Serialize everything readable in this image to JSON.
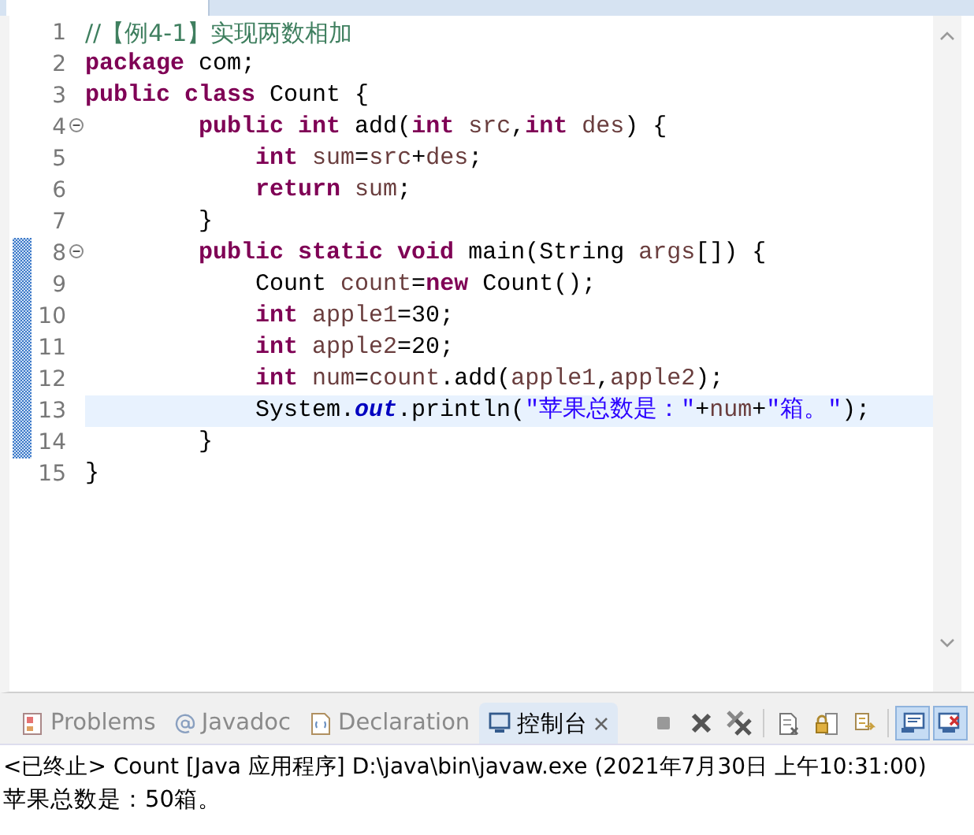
{
  "editor": {
    "lines": [
      {
        "number": "1",
        "fold": false,
        "changed": false,
        "current": false,
        "tokens": [
          {
            "kind": "comment",
            "text": "//【例4-1】实现两数相加"
          }
        ]
      },
      {
        "number": "2",
        "fold": false,
        "changed": false,
        "current": false,
        "tokens": [
          {
            "kind": "keyword",
            "text": "package"
          },
          {
            "kind": "plain",
            "text": " com;"
          }
        ]
      },
      {
        "number": "3",
        "fold": false,
        "changed": false,
        "current": false,
        "tokens": [
          {
            "kind": "keyword",
            "text": "public"
          },
          {
            "kind": "keyword",
            "text": " class"
          },
          {
            "kind": "plain",
            "text": " Count {"
          }
        ]
      },
      {
        "number": "4",
        "fold": true,
        "changed": false,
        "current": false,
        "tokens": [
          {
            "kind": "keyword",
            "text": "        public"
          },
          {
            "kind": "keyword",
            "text": " int"
          },
          {
            "kind": "plain",
            "text": " add("
          },
          {
            "kind": "keyword",
            "text": "int"
          },
          {
            "kind": "variable",
            "text": " src"
          },
          {
            "kind": "plain",
            "text": ","
          },
          {
            "kind": "keyword",
            "text": "int"
          },
          {
            "kind": "variable",
            "text": " des"
          },
          {
            "kind": "plain",
            "text": ") {"
          }
        ]
      },
      {
        "number": "5",
        "fold": false,
        "changed": false,
        "current": false,
        "tokens": [
          {
            "kind": "keyword",
            "text": "            int"
          },
          {
            "kind": "variable",
            "text": " sum"
          },
          {
            "kind": "plain",
            "text": "="
          },
          {
            "kind": "variable",
            "text": "src"
          },
          {
            "kind": "plain",
            "text": "+"
          },
          {
            "kind": "variable",
            "text": "des"
          },
          {
            "kind": "plain",
            "text": ";"
          }
        ]
      },
      {
        "number": "6",
        "fold": false,
        "changed": false,
        "current": false,
        "tokens": [
          {
            "kind": "keyword",
            "text": "            return"
          },
          {
            "kind": "variable",
            "text": " sum"
          },
          {
            "kind": "plain",
            "text": ";"
          }
        ]
      },
      {
        "number": "7",
        "fold": false,
        "changed": false,
        "current": false,
        "tokens": [
          {
            "kind": "plain",
            "text": "        }"
          }
        ]
      },
      {
        "number": "8",
        "fold": true,
        "changed": true,
        "current": false,
        "tokens": [
          {
            "kind": "keyword",
            "text": "        public"
          },
          {
            "kind": "keyword",
            "text": " static"
          },
          {
            "kind": "keyword",
            "text": " void"
          },
          {
            "kind": "plain",
            "text": " main(String"
          },
          {
            "kind": "variable",
            "text": " args"
          },
          {
            "kind": "plain",
            "text": "[]) {"
          }
        ]
      },
      {
        "number": "9",
        "fold": false,
        "changed": true,
        "current": false,
        "tokens": [
          {
            "kind": "plain",
            "text": "            Count"
          },
          {
            "kind": "variable",
            "text": " count"
          },
          {
            "kind": "plain",
            "text": "="
          },
          {
            "kind": "keyword",
            "text": "new"
          },
          {
            "kind": "plain",
            "text": " Count();"
          }
        ]
      },
      {
        "number": "10",
        "fold": false,
        "changed": true,
        "current": false,
        "tokens": [
          {
            "kind": "keyword",
            "text": "            int"
          },
          {
            "kind": "variable",
            "text": " apple1"
          },
          {
            "kind": "plain",
            "text": "=30;"
          }
        ]
      },
      {
        "number": "11",
        "fold": false,
        "changed": true,
        "current": false,
        "tokens": [
          {
            "kind": "keyword",
            "text": "            int"
          },
          {
            "kind": "variable",
            "text": " apple2"
          },
          {
            "kind": "plain",
            "text": "=20;"
          }
        ]
      },
      {
        "number": "12",
        "fold": false,
        "changed": true,
        "current": false,
        "tokens": [
          {
            "kind": "keyword",
            "text": "            int"
          },
          {
            "kind": "variable",
            "text": " num"
          },
          {
            "kind": "plain",
            "text": "="
          },
          {
            "kind": "variable",
            "text": "count"
          },
          {
            "kind": "plain",
            "text": ".add("
          },
          {
            "kind": "variable",
            "text": "apple1"
          },
          {
            "kind": "plain",
            "text": ","
          },
          {
            "kind": "variable",
            "text": "apple2"
          },
          {
            "kind": "plain",
            "text": ");"
          }
        ]
      },
      {
        "number": "13",
        "fold": false,
        "changed": true,
        "current": true,
        "tokens": [
          {
            "kind": "plain",
            "text": "            System."
          },
          {
            "kind": "field",
            "text": "out"
          },
          {
            "kind": "plain",
            "text": ".println("
          },
          {
            "kind": "string",
            "text": "\"苹果总数是：\""
          },
          {
            "kind": "plain",
            "text": "+"
          },
          {
            "kind": "variable",
            "text": "num"
          },
          {
            "kind": "plain",
            "text": "+"
          },
          {
            "kind": "string",
            "text": "\"箱。\""
          },
          {
            "kind": "plain",
            "text": ");"
          }
        ]
      },
      {
        "number": "14",
        "fold": false,
        "changed": true,
        "current": false,
        "tokens": [
          {
            "kind": "plain",
            "text": "        }"
          }
        ]
      },
      {
        "number": "15",
        "fold": false,
        "changed": false,
        "current": false,
        "tokens": [
          {
            "kind": "plain",
            "text": "}"
          }
        ]
      }
    ]
  },
  "panel_tabs": [
    {
      "kind": "problems",
      "label": "Problems",
      "selected": false,
      "closable": false
    },
    {
      "kind": "javadoc",
      "label": "Javadoc",
      "selected": false,
      "closable": false
    },
    {
      "kind": "declaration",
      "label": "Declaration",
      "selected": false,
      "closable": false
    },
    {
      "kind": "console",
      "label": "控制台",
      "selected": true,
      "closable": true
    }
  ],
  "toolbar": [
    {
      "kind": "terminate",
      "selected": false
    },
    {
      "kind": "remove",
      "selected": false
    },
    {
      "kind": "remove-all",
      "selected": false
    },
    {
      "kind": "clear",
      "selected": false
    },
    {
      "kind": "lock",
      "selected": false
    },
    {
      "kind": "pin",
      "selected": false
    },
    {
      "kind": "display",
      "selected": true
    },
    {
      "kind": "display-error",
      "selected": true
    }
  ],
  "console": {
    "header": "<已终止> Count [Java 应用程序] D:\\java\\bin\\javaw.exe  (2021年7月30日 上午10:31:00)",
    "output": "苹果总数是：50箱。"
  }
}
